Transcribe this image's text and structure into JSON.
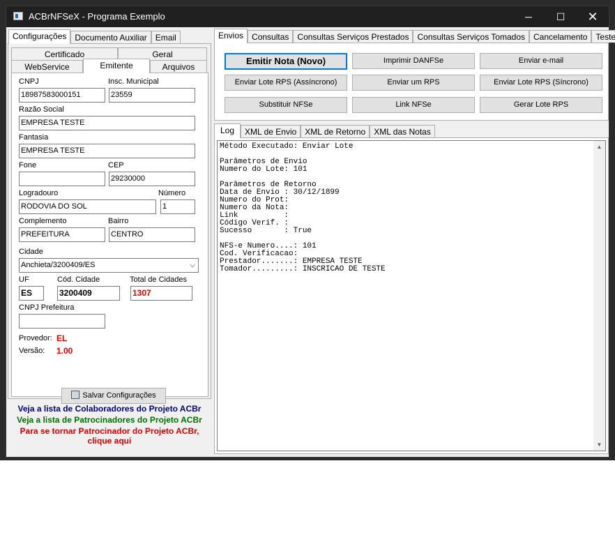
{
  "window": {
    "title": "ACBrNFSeX - Programa Exemplo",
    "min_symbol": "─",
    "max_symbol": "☐",
    "close_symbol": "✕"
  },
  "left_tabs": [
    "Configurações",
    "Documento Auxiliar",
    "Email"
  ],
  "config_tabs_row1": [
    "Certificado",
    "Geral"
  ],
  "config_tabs_row2": [
    "WebService",
    "Emitente",
    "Arquivos"
  ],
  "emitente": {
    "cnpj_label": "CNPJ",
    "cnpj": "18987583000151",
    "im_label": "Insc. Municipal",
    "im": "23559",
    "razao_label": "Razão Social",
    "razao": "EMPRESA TESTE",
    "fantasia_label": "Fantasia",
    "fantasia": "EMPRESA TESTE",
    "fone_label": "Fone",
    "fone": "",
    "cep_label": "CEP",
    "cep": "29230000",
    "logradouro_label": "Logradouro",
    "logradouro": "RODOVIA DO SOL",
    "numero_label": "Número",
    "numero": "1",
    "complemento_label": "Complemento",
    "complemento": "PREFEITURA",
    "bairro_label": "Bairro",
    "bairro": "CENTRO",
    "cidade_label": "Cidade",
    "cidade": "Anchieta/3200409/ES",
    "uf_label": "UF",
    "uf": "ES",
    "cod_cidade_label": "Cód. Cidade",
    "cod_cidade": "3200409",
    "total_cidades_label": "Total de Cidades",
    "total_cidades": "1307",
    "cnpj_prefeitura_label": "CNPJ Prefeitura",
    "cnpj_prefeitura": "",
    "provedor_label": "Provedor:",
    "provedor": "EL",
    "versao_label": "Versão:",
    "versao": "1.00"
  },
  "save_button": "Salvar Configurações",
  "links": {
    "colaboradores": "Veja a lista de Colaboradores do Projeto ACBr",
    "patrocinadores": "Veja a lista de Patrocinadores do Projeto ACBr",
    "tornar_line1": "Para se tornar Patrocinador do Projeto ACBr,",
    "tornar_line2": "clique aqui"
  },
  "link_colors": {
    "colaboradores": "#000080",
    "patrocinadores": "#007000",
    "tornar": "#e00000"
  },
  "right_tabs": [
    "Envios",
    "Consultas",
    "Consultas Serviços Prestados",
    "Consultas Serviços Tomados",
    "Cancelamento",
    "Teste"
  ],
  "envios_buttons": {
    "emitir_nota": "Emitir Nota (Novo)",
    "imprimir_danfse": "Imprimir DANFSe",
    "enviar_email": "Enviar e-mail",
    "enviar_lote_assincrono": "Enviar Lote RPS (Assíncrono)",
    "enviar_um_rps": "Enviar um RPS",
    "enviar_lote_sincrono": "Enviar Lote RPS (Síncrono)",
    "substituir_nfse": "Substituir NFSe",
    "link_nfse": "Link NFSe",
    "gerar_lote_rps": "Gerar Lote RPS"
  },
  "log_tabs": [
    "Log",
    "XML de Envio",
    "XML de Retorno",
    "XML das Notas"
  ],
  "log_text": "Método Executado: Enviar Lote\n\nParâmetros de Envio\nNumero do Lote: 101\n\nParâmetros de Retorno\nData de Envio : 30/12/1899\nNumero do Prot:\nNumero da Nota:\nLink          :\nCódigo Verif. :\nSucesso       : True\n\nNFS-e Numero....: 101\nCod. Verificacao:\nPrestador.......: EMPRESA TESTE\nTomador.........: INSCRICAO DE TESTE",
  "accent_color": "#0078d7"
}
